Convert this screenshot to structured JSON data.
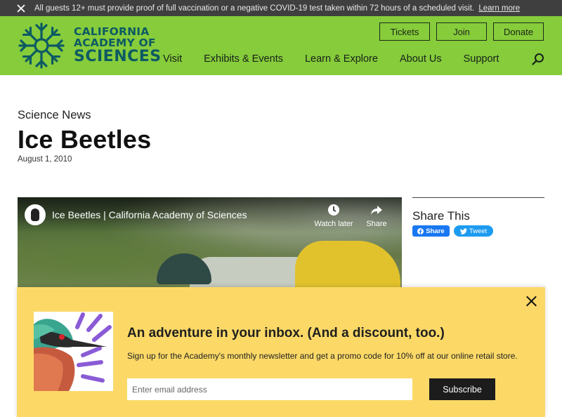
{
  "alert": {
    "message": "All guests 12+ must provide proof of full vaccination or a negative COVID-19 test taken within 72 hours of a scheduled visit.",
    "link": "Learn more"
  },
  "header": {
    "logo": {
      "line1": "CALIFORNIA",
      "line2": "ACADEMY OF",
      "line3": "SCIENCES"
    },
    "buttons": {
      "tickets": "Tickets",
      "join": "Join",
      "donate": "Donate"
    },
    "nav": [
      "Visit",
      "Exhibits & Events",
      "Learn & Explore",
      "About Us",
      "Support"
    ],
    "colors": {
      "green": "#86cc3b",
      "logo": "#0d5a63"
    }
  },
  "article": {
    "kicker": "Science News",
    "title": "Ice Beetles",
    "date": "August 1, 2010"
  },
  "video": {
    "title": "Ice Beetles | California Academy of Sciences",
    "watch_later": "Watch later",
    "share": "Share"
  },
  "share": {
    "title": "Share This",
    "facebook": "Share",
    "twitter": "Tweet"
  },
  "newsletter": {
    "heading": "An adventure in your inbox. (And a discount, too.)",
    "subtext": "Sign up for the Academy's monthly newsletter and get a promo code for 10% off at our online retail store.",
    "email_placeholder": "Enter email address",
    "button": "Subscribe",
    "background": "#fcd967"
  }
}
